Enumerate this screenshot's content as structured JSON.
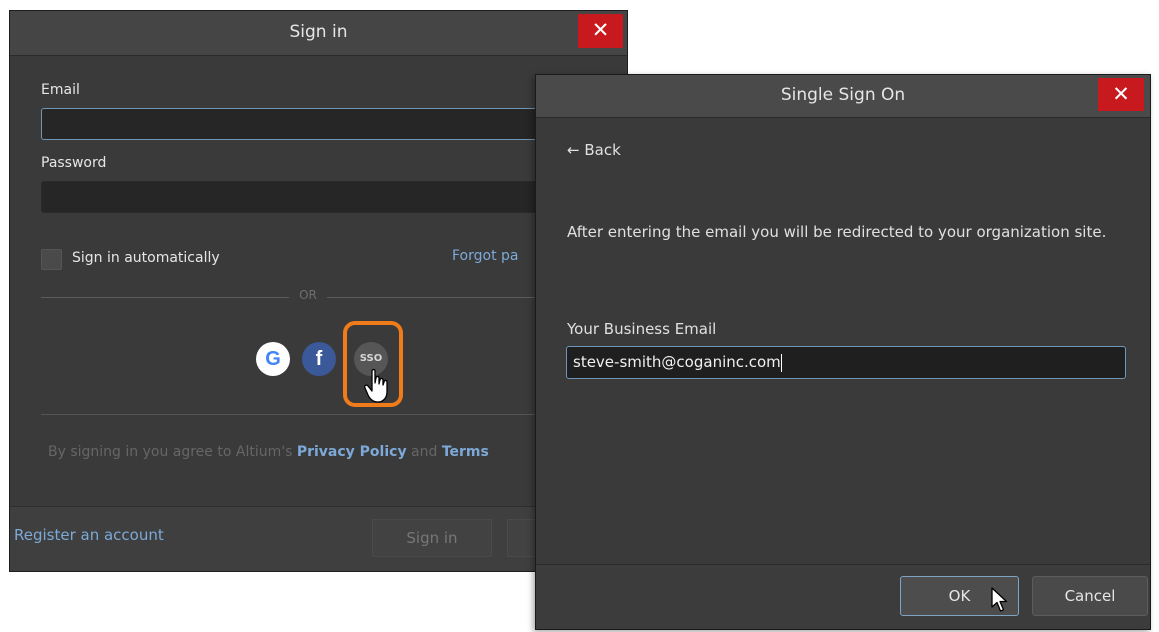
{
  "signin": {
    "title": "Sign in",
    "close_glyph": "✕",
    "email_label": "Email",
    "email_value": "",
    "password_label": "Password",
    "auto_label": "Sign in automatically",
    "forgot_label": "Forgot pa",
    "or_label": "OR",
    "google_glyph": "G",
    "facebook_glyph": "f",
    "sso_label": "SSO",
    "agree_prefix": "By signing in you agree to Altium's",
    "privacy_label": "Privacy Policy",
    "and_text": "and",
    "terms_label": "Terms",
    "register_label": "Register an account",
    "signin_button": "Sign in"
  },
  "sso": {
    "title": "Single Sign On",
    "close_glyph": "✕",
    "back_label": "← Back",
    "info_text": "After entering the email you will be redirected to your organization site.",
    "email_label": "Your Business Email",
    "email_value": "steve-smith@coganinc.com",
    "ok_label": "OK",
    "cancel_label": "Cancel"
  },
  "colors": {
    "close_red": "#c8191f",
    "highlight_orange": "#f07b1a",
    "link_blue": "#7da9d8"
  }
}
